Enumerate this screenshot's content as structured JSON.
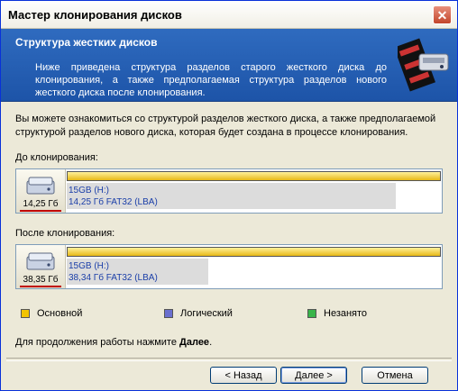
{
  "window": {
    "title": "Мастер клонирования дисков"
  },
  "banner": {
    "title": "Структура жестких дисков",
    "description": "Ниже приведена структура разделов старого жесткого диска до клонирования, а также предполагаемая структура разделов нового жесткого диска после клонирования."
  },
  "intro": "Вы можете ознакомиться со структурой разделов жесткого диска, а также предполагаемой структурой разделов нового диска, которая будет создана в процессе клонирования.",
  "before": {
    "label": "До клонирования:",
    "disk_size": "14,25 Гб",
    "partition_name": "15GB (H:)",
    "partition_info": "14,25 Гб  FAT32 (LBA)",
    "used_fraction": 0.93
  },
  "after": {
    "label": "После клонирования:",
    "disk_size": "38,35 Гб",
    "partition_name": "15GB (H:)",
    "partition_info": "38,34 Гб  FAT32 (LBA)",
    "used_fraction": 0.4
  },
  "legend": [
    {
      "label": "Основной",
      "color": "#f2c400"
    },
    {
      "label": "Логический",
      "color": "#6a6fcf"
    },
    {
      "label": "Незанято",
      "color": "#39b54a"
    }
  ],
  "continue_prefix": "Для продолжения работы нажмите ",
  "continue_bold": "Далее",
  "continue_suffix": ".",
  "buttons": {
    "back": "< Назад",
    "next": "Далее >",
    "cancel": "Отмена"
  }
}
